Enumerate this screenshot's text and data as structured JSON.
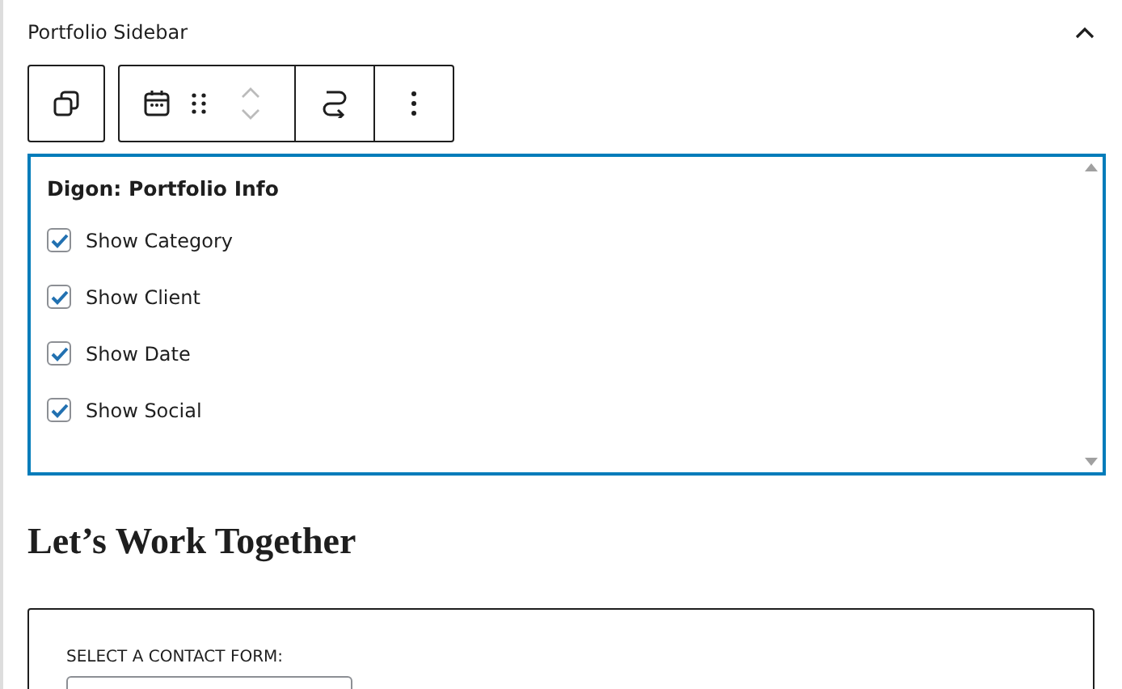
{
  "panel": {
    "title": "Portfolio Sidebar",
    "expanded": true
  },
  "widget": {
    "title": "Digon: Portfolio Info",
    "options": [
      {
        "label": "Show Category",
        "checked": true
      },
      {
        "label": "Show Client",
        "checked": true
      },
      {
        "label": "Show Date",
        "checked": true
      },
      {
        "label": "Show Social",
        "checked": true
      }
    ]
  },
  "heading": "Let’s Work Together",
  "form_card": {
    "label": "SELECT A CONTACT FORM:"
  }
}
